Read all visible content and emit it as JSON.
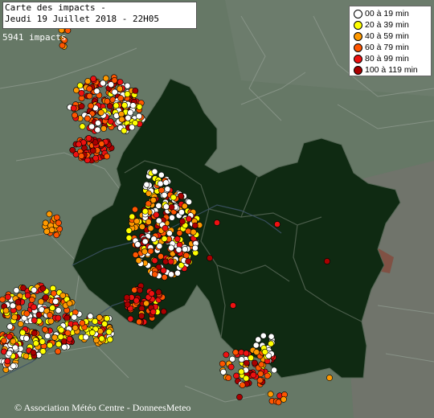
{
  "header": {
    "title_line1": "Carte des impacts -",
    "title_line2": "Jeudi 19 Juillet 2018 - 22H05",
    "impact_count": "5941 impacts"
  },
  "legend": [
    {
      "label": "00 à 19 min",
      "color": "#ffffff"
    },
    {
      "label": "20 à 39 min",
      "color": "#ffff00"
    },
    {
      "label": "40 à 59 min",
      "color": "#ff9900"
    },
    {
      "label": "60 à 79 min",
      "color": "#ff5500"
    },
    {
      "label": "80 à 99 min",
      "color": "#ee1111"
    },
    {
      "label": "100 à 119 min",
      "color": "#aa0000"
    }
  ],
  "credit": "© Association Météo Centre - DonneesMeteo",
  "colors": {
    "land": "#667866",
    "region": "#0f2a12",
    "borders": "#8e9a8e",
    "river": "#3d5266"
  }
}
